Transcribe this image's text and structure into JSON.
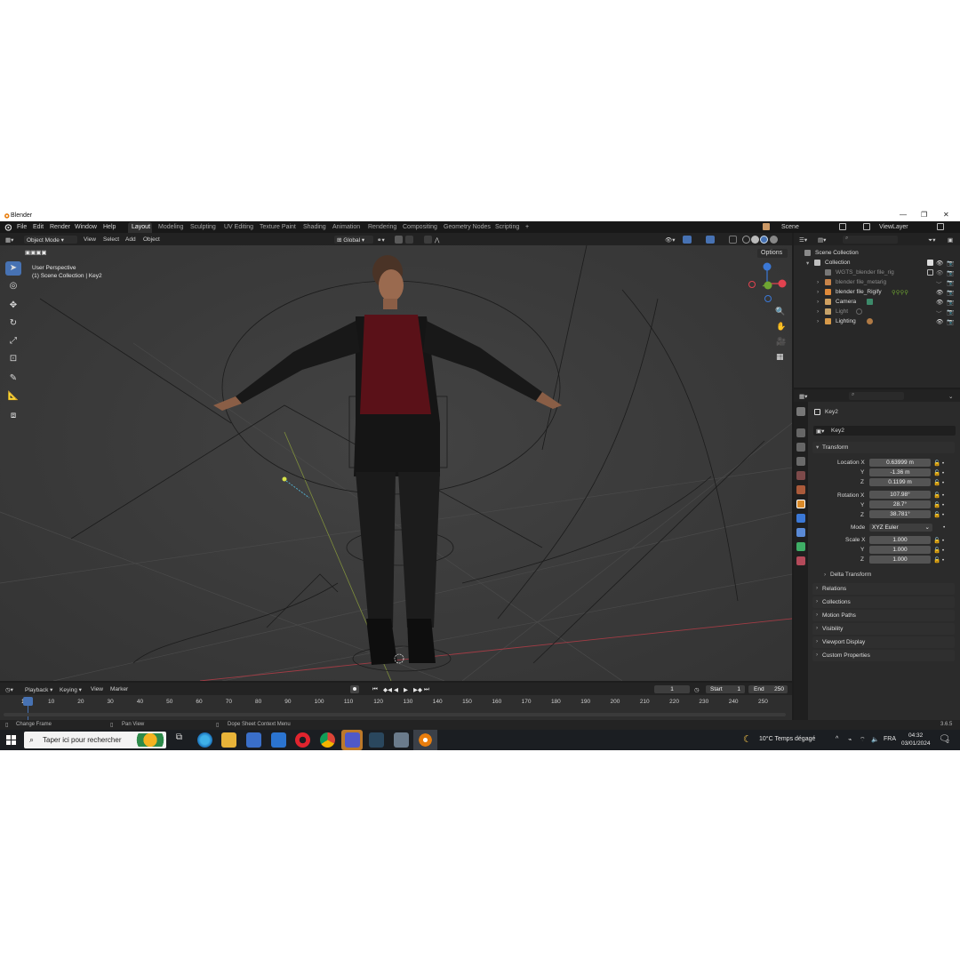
{
  "window": {
    "title": "Blender",
    "controls": [
      "—",
      "❐",
      "✕"
    ]
  },
  "topbar": {
    "menus": [
      "File",
      "Edit",
      "Render",
      "Window",
      "Help"
    ],
    "workspaces": [
      "Layout",
      "Modeling",
      "Sculpting",
      "UV Editing",
      "Texture Paint",
      "Shading",
      "Animation",
      "Rendering",
      "Compositing",
      "Geometry Nodes",
      "Scripting"
    ],
    "active_workspace": "Layout",
    "add_tab": "+",
    "scene": "Scene",
    "view_layer": "ViewLayer"
  },
  "viewport_header": {
    "mode": "Object Mode",
    "menus": [
      "View",
      "Select",
      "Add",
      "Object"
    ],
    "orientation": "Global",
    "options": "Options"
  },
  "viewport": {
    "perspective": "User Perspective",
    "collection": "(1) Scene Collection | Key2",
    "gizmo_axes": [
      "X",
      "Y",
      "Z"
    ]
  },
  "outliner": {
    "root": "Scene Collection",
    "collection": "Collection",
    "items": [
      {
        "name": "WGTS_blender file_rig",
        "dim": true,
        "color": "#777777"
      },
      {
        "name": "blender file_metarig",
        "dim": true,
        "color": "#c8844a"
      },
      {
        "name": "blender file_Rigify",
        "dim": false,
        "color": "#e08a3a"
      },
      {
        "name": "Camera",
        "dim": false,
        "color": "#d0a060"
      },
      {
        "name": "Light",
        "dim": true,
        "color": "#c7a36a"
      },
      {
        "name": "Lighting",
        "dim": false,
        "color": "#d79a4a"
      }
    ]
  },
  "properties": {
    "object_name": "Key2",
    "data_name": "Key2",
    "transform_label": "Transform",
    "location_label": "Location X",
    "location": [
      "0.63999 m",
      "-1.36 m",
      "0.1199 m"
    ],
    "rotation_label": "Rotation X",
    "rotation": [
      "107.98°",
      "28.7°",
      "38.781°"
    ],
    "mode_label": "Mode",
    "mode_value": "XYZ Euler",
    "scale_label": "Scale X",
    "scale": [
      "1.000",
      "1.000",
      "1.000"
    ],
    "axis_y": "Y",
    "axis_z": "Z",
    "sections": [
      "Delta Transform",
      "Relations",
      "Collections",
      "Motion Paths",
      "Visibility",
      "Viewport Display",
      "Custom Properties"
    ]
  },
  "timeline": {
    "menus": [
      "Playback",
      "Keying",
      "View",
      "Marker"
    ],
    "current_frame": "1",
    "start_label": "Start",
    "start": "1",
    "end_label": "End",
    "end": "250",
    "ticks": [
      "1",
      "10",
      "20",
      "30",
      "40",
      "50",
      "60",
      "70",
      "80",
      "90",
      "100",
      "110",
      "120",
      "130",
      "140",
      "150",
      "160",
      "170",
      "180",
      "190",
      "200",
      "210",
      "220",
      "230",
      "240",
      "250"
    ]
  },
  "statusbar": {
    "left": "Change Frame",
    "middle": "Pan View",
    "right_hint": "Dope Sheet Context Menu",
    "version": "3.6.5"
  },
  "taskbar": {
    "search_placeholder": "Taper ici pour rechercher",
    "weather": "10°C  Temps dégagé",
    "language": "FRA",
    "time": "04:32",
    "date": "03/01/2024",
    "notifications": "2"
  },
  "colors": {
    "accent": "#4772b3",
    "timeline_cursor": "#4772b3",
    "axis_x": "#e2424f",
    "axis_y": "#6fa532",
    "axis_z": "#3b78d6"
  }
}
